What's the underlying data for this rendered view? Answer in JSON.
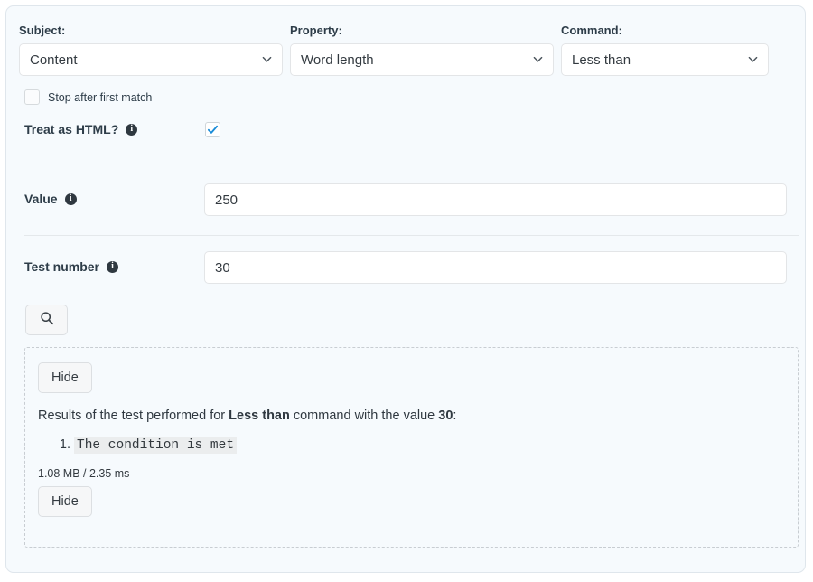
{
  "selectors": [
    {
      "label": "Subject:",
      "value": "Content",
      "icon": "chevron-down-icon",
      "name": "subject"
    },
    {
      "label": "Property:",
      "value": "Word length",
      "icon": "chevron-down-icon",
      "name": "property"
    },
    {
      "label": "Command:",
      "value": "Less than",
      "icon": "chevron-down-icon",
      "name": "command"
    }
  ],
  "stop_after_first_match": {
    "label": "Stop after first match",
    "checked": false
  },
  "treat_as_html": {
    "label": "Treat as HTML?",
    "info_icon": "info-icon",
    "info_glyph": "i",
    "checked": true,
    "check_color": "#1a8cd8"
  },
  "fields": [
    {
      "label": "Value",
      "info_glyph": "i",
      "value": "250",
      "placeholder": ""
    },
    {
      "label": "Test number",
      "info_glyph": "i",
      "value": "30",
      "placeholder": ""
    }
  ],
  "search_button": {
    "icon": "search-icon",
    "label": ""
  },
  "results": {
    "hide_top_label": "Hide",
    "hide_bottom_label": "Hide",
    "sentence_prefix": "Results of the test performed for ",
    "sentence_command": "Less than",
    "sentence_middle": " command with the value ",
    "sentence_value": "30",
    "sentence_suffix": ":",
    "items": [
      "The condition is met"
    ],
    "meta": "1.08 MB / 2.35 ms"
  },
  "colors": {
    "panel_background": "#f6fafd",
    "panel_border": "#dfe6ec",
    "text": "#2e3d49",
    "accent": "#1a8cd8",
    "dashed_border": "#c8cdd2"
  }
}
